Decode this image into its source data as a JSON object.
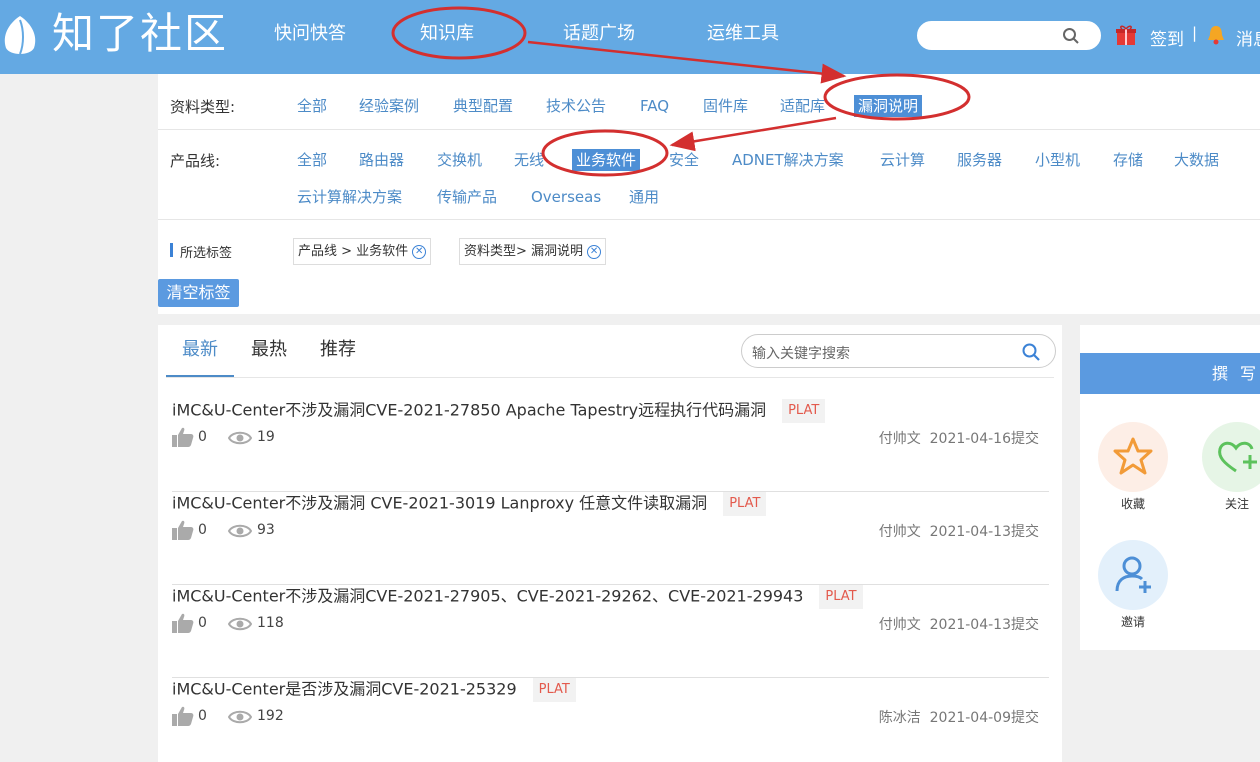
{
  "header": {
    "logo_text": "知了社区",
    "nav": [
      "快问快答",
      "知识库",
      "话题广场",
      "运维工具"
    ],
    "signin": "签到",
    "separator": "|",
    "messages": "消息"
  },
  "filters": {
    "type_label": "资料类型:",
    "types": [
      "全部",
      "经验案例",
      "典型配置",
      "技术公告",
      "FAQ",
      "固件库",
      "适配库",
      "漏洞说明"
    ],
    "product_label": "产品线:",
    "products_row1": [
      "全部",
      "路由器",
      "交换机",
      "无线",
      "业务软件",
      "安全",
      "ADNET解决方案",
      "云计算",
      "服务器",
      "小型机",
      "存储",
      "大数据"
    ],
    "products_row2": [
      "云计算解决方案",
      "传输产品",
      "Overseas",
      "通用"
    ],
    "selected_label": "所选标签",
    "selected_tags": [
      "产品线 >  业务软件",
      "资料类型>  漏洞说明"
    ],
    "clear_button": "清空标签"
  },
  "list": {
    "tabs": [
      "最新",
      "最热",
      "推荐"
    ],
    "search_placeholder": "输入关键字搜索",
    "items": [
      {
        "title": "iMC&U-Center不涉及漏洞CVE-2021-27850 Apache Tapestry远程执行代码漏洞",
        "tag": "PLAT",
        "likes": "0",
        "views": "19",
        "author": "付帅文",
        "date": "2021-04-16提交"
      },
      {
        "title": "iMC&U-Center不涉及漏洞 CVE-2021-3019 Lanproxy 任意文件读取漏洞",
        "tag": "PLAT",
        "likes": "0",
        "views": "93",
        "author": "付帅文",
        "date": "2021-04-13提交"
      },
      {
        "title": "iMC&U-Center不涉及漏洞CVE-2021-27905、CVE-2021-29262、CVE-2021-29943",
        "tag": "PLAT",
        "likes": "0",
        "views": "118",
        "author": "付帅文",
        "date": "2021-04-13提交"
      },
      {
        "title": "iMC&U-Center是否涉及漏洞CVE-2021-25329",
        "tag": "PLAT",
        "likes": "0",
        "views": "192",
        "author": "陈冰洁",
        "date": "2021-04-09提交"
      }
    ]
  },
  "sidebar": {
    "write_button": "撰写",
    "actions": [
      "收藏",
      "关注",
      "邀请"
    ]
  },
  "colors": {
    "header_bg": "#64a9e3",
    "accent": "#4d8bc7",
    "active_tag": "#4d8fd6",
    "plat_tag": "#e35a4d",
    "annotation": "#d32f2f"
  },
  "icons": [
    "logo-icon",
    "search-icon",
    "gift-icon",
    "bell-icon",
    "close-circle-icon",
    "thumbs-up-icon",
    "eye-icon",
    "star-icon",
    "heart-plus-icon",
    "user-plus-icon"
  ]
}
